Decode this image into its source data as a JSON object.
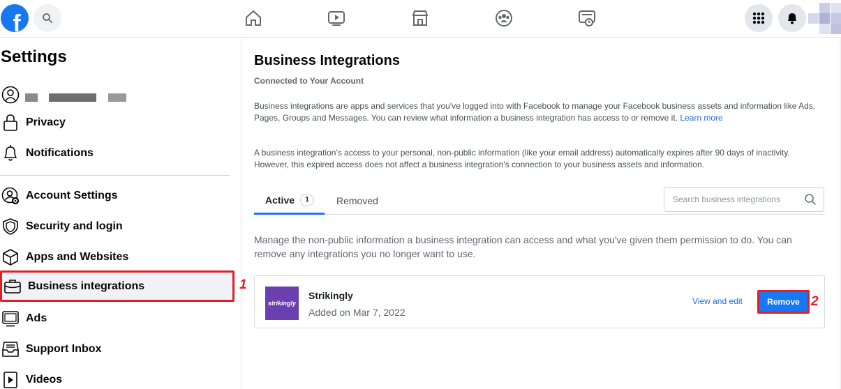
{
  "topbar": {
    "logo_letter": "f",
    "nav_icons": [
      "home-icon",
      "watch-icon",
      "marketplace-icon",
      "groups-icon",
      "gaming-icon"
    ],
    "right_icons": [
      "menu-grid-icon",
      "notifications-bell-icon",
      "avatar"
    ]
  },
  "sidebar": {
    "title": "Settings",
    "items": [
      {
        "label": "Privacy",
        "icon": "lock-icon"
      },
      {
        "label": "Notifications",
        "icon": "bell-icon"
      },
      {
        "label": "Account Settings",
        "icon": "user-gear-icon"
      },
      {
        "label": "Security and login",
        "icon": "shield-icon"
      },
      {
        "label": "Apps and Websites",
        "icon": "cube-icon"
      },
      {
        "label": "Business integrations",
        "icon": "briefcase-icon"
      },
      {
        "label": "Ads",
        "icon": "ads-monitor-icon"
      },
      {
        "label": "Support Inbox",
        "icon": "inbox-icon"
      },
      {
        "label": "Videos",
        "icon": "video-icon"
      }
    ],
    "marker_1": "1"
  },
  "main": {
    "title": "Business Integrations",
    "subtitle": "Connected to Your Account",
    "para1": "Business integrations are apps and services that you've logged into with Facebook to manage your Facebook business assets and information like Ads, Pages, Groups and Messages. You can review what information a business integration has access to or remove it.",
    "para1_link": "Learn more",
    "para2": "A business integration's access to your personal, non-public information (like your email address) automatically expires after 90 days of inactivity. However, this expired access does not affect a business integration's connection to your business assets and information.",
    "tabs": {
      "active_label": "Active",
      "active_count": "1",
      "removed_label": "Removed"
    },
    "search_placeholder": "Search business integrations",
    "manage_text": "Manage the non-public information a business integration can access and what you've given them permission to do. You can remove any integrations you no longer want to use.",
    "integration": {
      "logo_text": "strikingly",
      "name": "Strikingly",
      "added": "Added on Mar 7, 2022",
      "view_edit": "View and edit",
      "remove": "Remove"
    },
    "marker_2": "2"
  },
  "colors": {
    "brand": "#1877f2",
    "highlight": "#e41e26",
    "app_logo_bg": "#6a3fb0"
  }
}
